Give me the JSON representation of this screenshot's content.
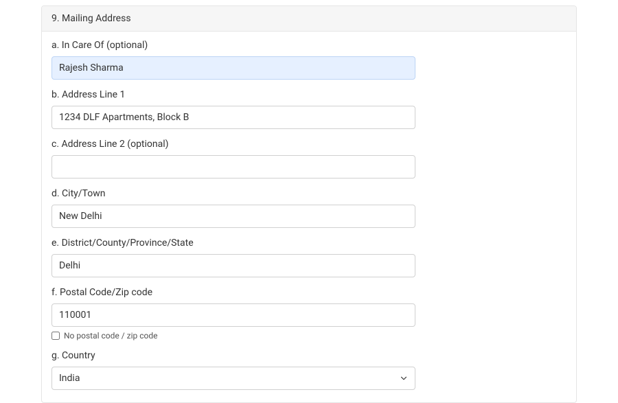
{
  "section": {
    "title": "9. Mailing Address"
  },
  "fields": {
    "in_care_of": {
      "label": "a. In Care Of (optional)",
      "value": "Rajesh Sharma"
    },
    "address_line_1": {
      "label": "b. Address Line 1",
      "value": "1234 DLF Apartments, Block B"
    },
    "address_line_2": {
      "label": "c. Address Line 2 (optional)",
      "value": ""
    },
    "city": {
      "label": "d. City/Town",
      "value": "New Delhi"
    },
    "district": {
      "label": "e. District/County/Province/State",
      "value": "Delhi"
    },
    "postal_code": {
      "label": "f. Postal Code/Zip code",
      "value": "110001",
      "no_postal_label": "No postal code / zip code",
      "no_postal_checked": false
    },
    "country": {
      "label": "g. Country",
      "value": "India"
    }
  }
}
